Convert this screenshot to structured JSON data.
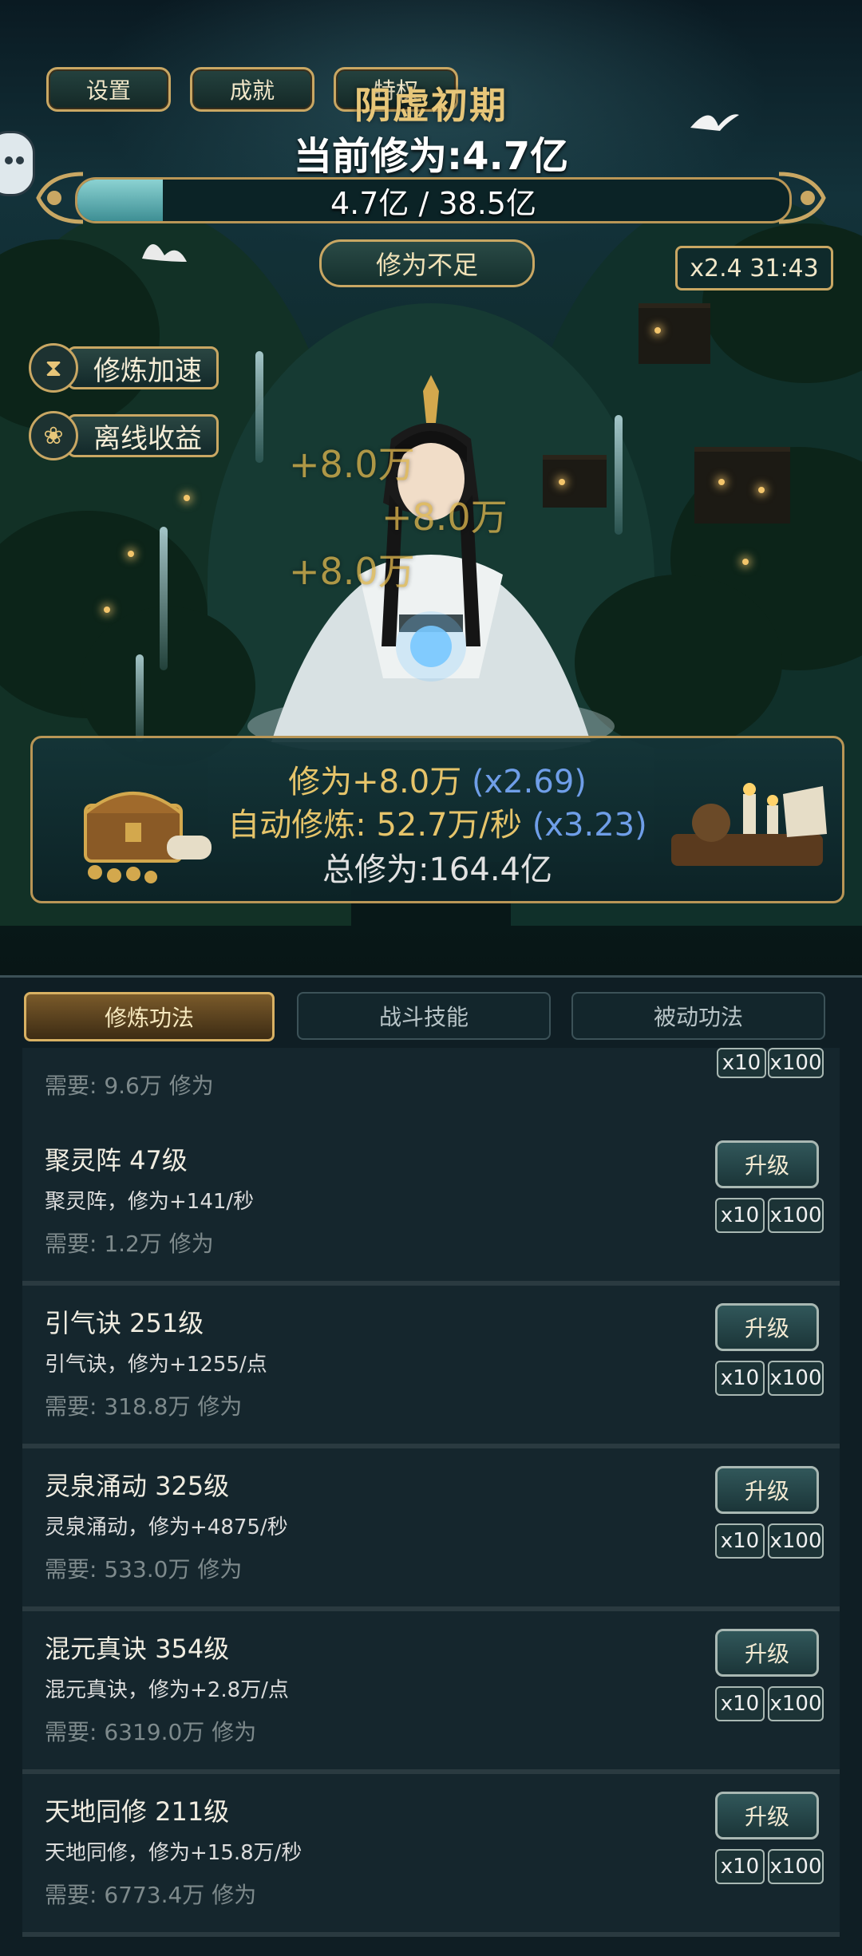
{
  "top_buttons": {
    "settings": "设置",
    "achievements": "成就",
    "privileges": "特权"
  },
  "realm": "阴虚初期",
  "current_cultivation": "当前修为:4.7亿",
  "progress": {
    "text": "4.7亿 / 38.5亿",
    "fraction": 0.12
  },
  "insufficient_label": "修为不足",
  "multiplier_timer": "x2.4 31:43",
  "side_buttons": {
    "speedup": "修炼加速",
    "offline": "离线收益"
  },
  "floating_gains": [
    "+8.0万",
    "+8.0万",
    "+8.0万"
  ],
  "stats": {
    "click_gain": "修为+8.0万",
    "click_mult": "(x2.69)",
    "auto_gain": "自动修炼: 52.7万/秒",
    "auto_mult": "(x3.23)",
    "total": "总修为:164.4亿"
  },
  "tabs": [
    "修炼功法",
    "战斗技能",
    "被动功法"
  ],
  "partial_req": "需要: 9.6万 修为",
  "upgrade_label": "升级",
  "mult_buttons": [
    "x10",
    "x100"
  ],
  "skills": [
    {
      "title": "聚灵阵 47级",
      "desc": "聚灵阵，修为+141/秒",
      "req": "需要: 1.2万 修为"
    },
    {
      "title": "引气诀 251级",
      "desc": "引气诀，修为+1255/点",
      "req": "需要: 318.8万 修为"
    },
    {
      "title": "灵泉涌动 325级",
      "desc": "灵泉涌动，修为+4875/秒",
      "req": "需要: 533.0万 修为"
    },
    {
      "title": "混元真诀 354级",
      "desc": "混元真诀，修为+2.8万/点",
      "req": "需要: 6319.0万 修为"
    },
    {
      "title": "天地同修 211级",
      "desc": "天地同修，修为+15.8万/秒",
      "req": "需要: 6773.4万 修为"
    }
  ]
}
